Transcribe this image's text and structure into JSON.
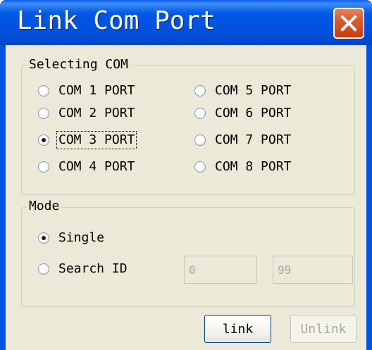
{
  "window": {
    "title": "Link Com Port"
  },
  "icons": {
    "close": "close-icon"
  },
  "colors": {
    "titlebar": "#0054e3",
    "client_background": "#ece9d8",
    "close_button": "#d95b2c"
  },
  "selecting_com": {
    "legend": "Selecting COM",
    "selected": "COM 3 PORT",
    "ports": [
      {
        "label": "COM 1 PORT",
        "checked": false
      },
      {
        "label": "COM 2 PORT",
        "checked": false
      },
      {
        "label": "COM 3 PORT",
        "checked": true
      },
      {
        "label": "COM 4 PORT",
        "checked": false
      },
      {
        "label": "COM 5 PORT",
        "checked": false
      },
      {
        "label": "COM 6 PORT",
        "checked": false
      },
      {
        "label": "COM 7 PORT",
        "checked": false
      },
      {
        "label": "COM 8 PORT",
        "checked": false
      }
    ]
  },
  "mode": {
    "legend": "Mode",
    "selected": "Single",
    "single_label": "Single",
    "search_id_label": "Search ID",
    "id_from": "0",
    "id_to": "99"
  },
  "buttons": {
    "link_label": "link",
    "unlink_label": "Unlink"
  }
}
